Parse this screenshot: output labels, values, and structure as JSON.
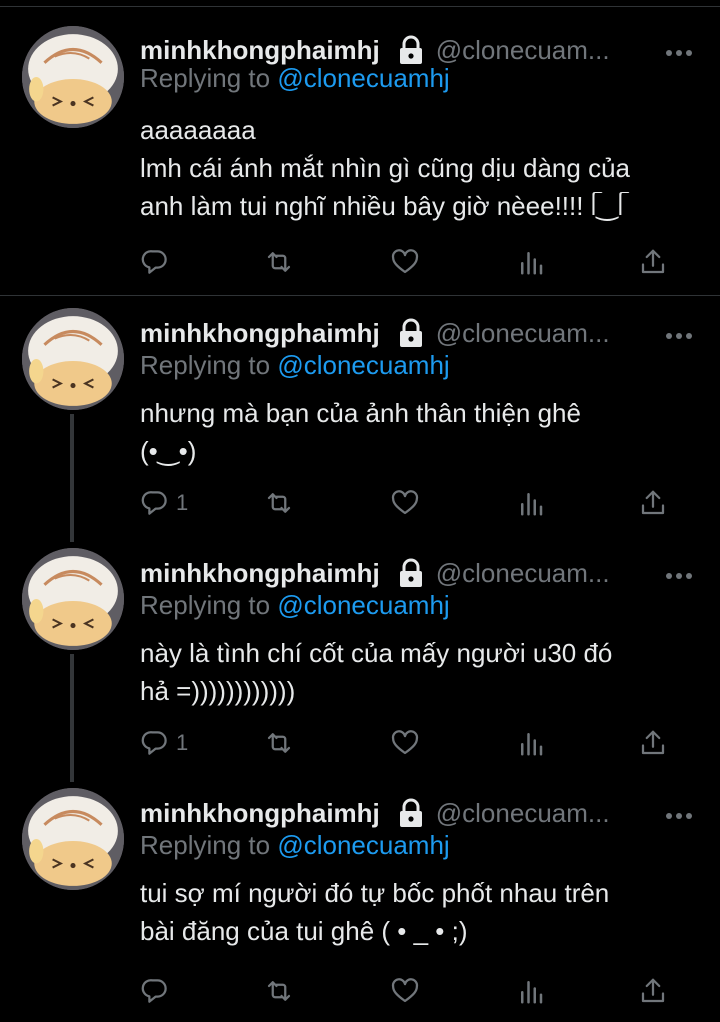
{
  "tweets": [
    {
      "author_name": "minhkhongphaimhj",
      "handle": "@clonecuam...",
      "replying_prefix": "Replying to",
      "replying_handle": "@clonecuamhj",
      "lines": [
        "aaaaaaaa",
        "lmh cái ánh mắt nhìn gì cũng dịu dàng của",
        "anh làm tui nghĩ nhiều bây giờ nèee!!!! ᥬ‿ᥬ"
      ],
      "reply_count": ""
    },
    {
      "author_name": "minhkhongphaimhj",
      "handle": "@clonecuam...",
      "replying_prefix": "Replying to",
      "replying_handle": "@clonecuamhj",
      "lines": [
        "nhưng mà bạn của ảnh thân thiện ghê",
        "(•‿•)"
      ],
      "reply_count": "1"
    },
    {
      "author_name": "minhkhongphaimhj",
      "handle": "@clonecuam...",
      "replying_prefix": "Replying to",
      "replying_handle": "@clonecuamhj",
      "lines": [
        "này là tình chí cốt của mấy người u30 đó",
        "hả =))))))))))))"
      ],
      "reply_count": "1"
    },
    {
      "author_name": "minhkhongphaimhj",
      "handle": "@clonecuam...",
      "replying_prefix": "Replying to",
      "replying_handle": "@clonecuamhj",
      "lines": [
        "tui sợ mí người đó tự bốc phốt nhau trên",
        "bài đăng của tui ghê ( • _ • ;)"
      ],
      "reply_count": ""
    }
  ],
  "icons": {
    "reply": "reply-icon",
    "retweet": "retweet-icon",
    "like": "heart-icon",
    "views": "views-icon",
    "share": "share-icon",
    "lock": "lock-icon",
    "more": "more-icon"
  },
  "colors": {
    "background": "#000000",
    "text": "#e7e9ea",
    "muted": "#71767b",
    "link": "#1d9bf0",
    "divider": "#2f3336"
  }
}
